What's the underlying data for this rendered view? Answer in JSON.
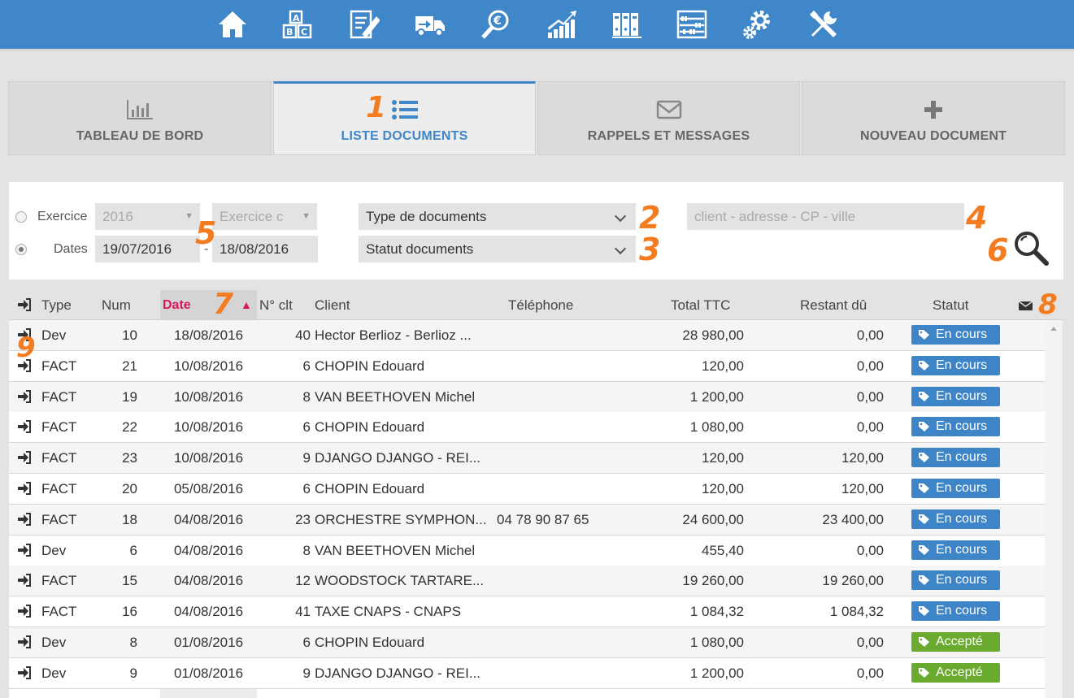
{
  "topbar": {
    "icons": [
      "home-icon",
      "abc-blocks-icon",
      "document-edit-icon",
      "delivery-truck-icon",
      "euro-search-icon",
      "growth-chart-icon",
      "binders-icon",
      "abacus-icon",
      "gears-icon",
      "tools-icon"
    ],
    "color": "#3f87c9"
  },
  "tabs": [
    {
      "label": "TABLEAU DE BORD",
      "icon": "bar-chart-icon"
    },
    {
      "label": "LISTE DOCUMENTS",
      "icon": "list-icon",
      "active": true
    },
    {
      "label": "RAPPELS ET MESSAGES",
      "icon": "envelope-icon"
    },
    {
      "label": "NOUVEAU DOCUMENT",
      "icon": "plus-icon"
    }
  ],
  "filters": {
    "exercice_label": "Exercice",
    "exercice_year": "2016",
    "exercice_c": "Exercice c",
    "dates_label": "Dates",
    "date_from": "19/07/2016",
    "date_sep": "-",
    "date_to": "18/08/2016",
    "type_documents": "Type de documents",
    "statut_documents": "Statut documents",
    "search_placeholder": "client - adresse - CP - ville",
    "selected_mode": "Dates"
  },
  "annotations": [
    "1",
    "2",
    "3",
    "4",
    "5",
    "6",
    "7",
    "8",
    "9"
  ],
  "table": {
    "headers": {
      "type": "Type",
      "num": "Num",
      "date": "Date",
      "nclt": "N° clt",
      "client": "Client",
      "telephone": "Téléphone",
      "total_ttc": "Total TTC",
      "restant_du": "Restant dû",
      "statut": "Statut"
    },
    "sort": {
      "column": "Date",
      "direction": "desc",
      "indicator": "▲"
    },
    "rows": [
      {
        "type": "Dev",
        "num": "10",
        "date": "18/08/2016",
        "nclt": "40",
        "client": "Hector Berlioz - Berlioz ...",
        "telephone": "",
        "total": "28 980,00",
        "restant": "0,00",
        "statut": "En cours",
        "statut_color": "blue"
      },
      {
        "type": "FACT",
        "num": "21",
        "date": "10/08/2016",
        "nclt": "6",
        "client": "CHOPIN Edouard",
        "telephone": "",
        "total": "120,00",
        "restant": "0,00",
        "statut": "En cours",
        "statut_color": "blue"
      },
      {
        "type": "FACT",
        "num": "19",
        "date": "10/08/2016",
        "nclt": "8",
        "client": "VAN BEETHOVEN Michel",
        "telephone": "",
        "total": "1 200,00",
        "restant": "0,00",
        "statut": "En cours",
        "statut_color": "blue"
      },
      {
        "type": "FACT",
        "num": "22",
        "date": "10/08/2016",
        "nclt": "6",
        "client": "CHOPIN Edouard",
        "telephone": "",
        "total": "1 080,00",
        "restant": "0,00",
        "statut": "En cours",
        "statut_color": "blue"
      },
      {
        "type": "FACT",
        "num": "23",
        "date": "10/08/2016",
        "nclt": "9",
        "client": "DJANGO DJANGO - REI...",
        "telephone": "",
        "total": "120,00",
        "restant": "120,00",
        "statut": "En cours",
        "statut_color": "blue"
      },
      {
        "type": "FACT",
        "num": "20",
        "date": "05/08/2016",
        "nclt": "6",
        "client": "CHOPIN Edouard",
        "telephone": "",
        "total": "120,00",
        "restant": "120,00",
        "statut": "En cours",
        "statut_color": "blue"
      },
      {
        "type": "FACT",
        "num": "18",
        "date": "04/08/2016",
        "nclt": "23",
        "client": "ORCHESTRE SYMPHON...",
        "telephone": "04 78 90 87 65",
        "total": "24 600,00",
        "restant": "23 400,00",
        "statut": "En cours",
        "statut_color": "blue"
      },
      {
        "type": "Dev",
        "num": "6",
        "date": "04/08/2016",
        "nclt": "8",
        "client": "VAN BEETHOVEN Michel",
        "telephone": "",
        "total": "455,40",
        "restant": "0,00",
        "statut": "En cours",
        "statut_color": "blue"
      },
      {
        "type": "FACT",
        "num": "15",
        "date": "04/08/2016",
        "nclt": "12",
        "client": "WOODSTOCK TARTARE...",
        "telephone": "",
        "total": "19 260,00",
        "restant": "19 260,00",
        "statut": "En cours",
        "statut_color": "blue"
      },
      {
        "type": "FACT",
        "num": "16",
        "date": "04/08/2016",
        "nclt": "41",
        "client": "TAXE CNAPS - CNAPS",
        "telephone": "",
        "total": "1 084,32",
        "restant": "1 084,32",
        "statut": "En cours",
        "statut_color": "blue"
      },
      {
        "type": "Dev",
        "num": "8",
        "date": "01/08/2016",
        "nclt": "6",
        "client": "CHOPIN Edouard",
        "telephone": "",
        "total": "1 080,00",
        "restant": "0,00",
        "statut": "Accepté",
        "statut_color": "green"
      },
      {
        "type": "Dev",
        "num": "9",
        "date": "01/08/2016",
        "nclt": "9",
        "client": "DJANGO DJANGO - REI...",
        "telephone": "",
        "total": "1 200,00",
        "restant": "0,00",
        "statut": "Accepté",
        "statut_color": "green"
      }
    ]
  }
}
